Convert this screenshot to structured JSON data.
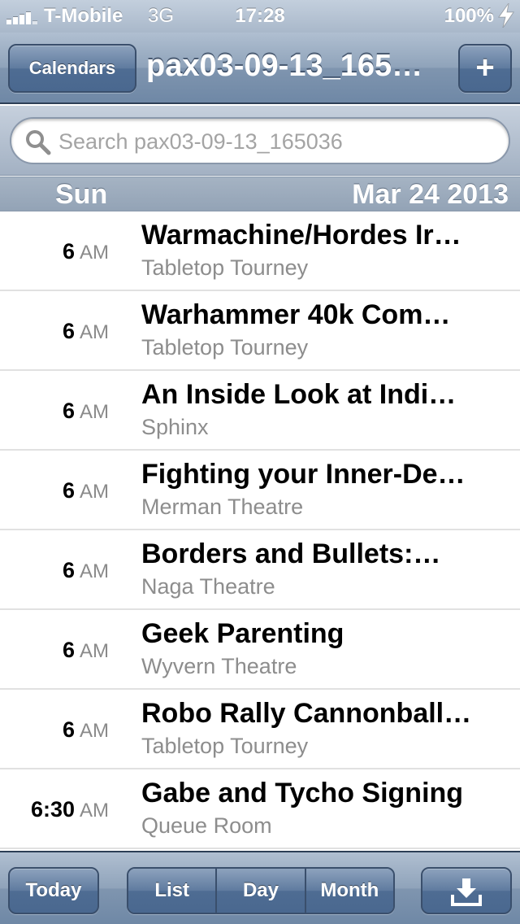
{
  "status_bar": {
    "carrier": "T-Mobile",
    "network": "3G",
    "time": "17:28",
    "battery": "100%",
    "icons": [
      "signal-bars-icon",
      "charging-bolt-icon"
    ]
  },
  "nav_bar": {
    "back_button_label": "Calendars",
    "title": "pax03-09-13_165…",
    "add_button_label": "+"
  },
  "search": {
    "placeholder": "Search pax03-09-13_165036",
    "value": "",
    "icon": "magnifier-icon"
  },
  "section_header": {
    "day": "Sun",
    "date": "Mar 24 2013"
  },
  "events": [
    {
      "hour": "6",
      "ampm": "AM",
      "title": "Warmachine/Hordes Ir…",
      "location": "Tabletop Tourney"
    },
    {
      "hour": "6",
      "ampm": "AM",
      "title": "Warhammer 40k Com…",
      "location": "Tabletop Tourney"
    },
    {
      "hour": "6",
      "ampm": "AM",
      "title": "An Inside Look at Indi…",
      "location": "Sphinx"
    },
    {
      "hour": "6",
      "ampm": "AM",
      "title": "Fighting your Inner-De…",
      "location": "Merman Theatre"
    },
    {
      "hour": "6",
      "ampm": "AM",
      "title": "Borders and Bullets:…",
      "location": "Naga Theatre"
    },
    {
      "hour": "6",
      "ampm": "AM",
      "title": "Geek Parenting",
      "location": "Wyvern Theatre"
    },
    {
      "hour": "6",
      "ampm": "AM",
      "title": "Robo Rally Cannonball…",
      "location": "Tabletop Tourney"
    },
    {
      "hour": "6:30",
      "ampm": "AM",
      "title": "Gabe and Tycho Signing",
      "location": "Queue Room"
    }
  ],
  "toolbar": {
    "today_label": "Today",
    "segments": [
      "List",
      "Day",
      "Month"
    ],
    "download_icon": "download-tray-icon"
  },
  "colors": {
    "bar_blue": "#6f88a6",
    "button_blue": "#4e6c93",
    "section_header": "#93a3b6",
    "location_gray": "#8d8d8d"
  }
}
